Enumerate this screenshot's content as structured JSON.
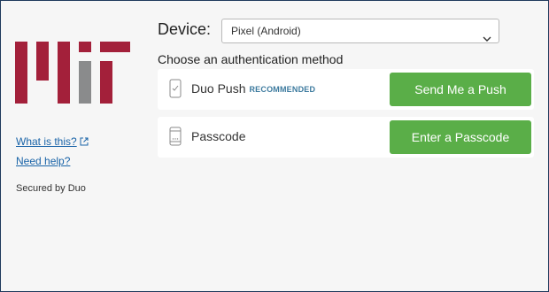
{
  "brand": {
    "logo_alt": "MIT",
    "colors": {
      "red": "#a3203a",
      "gray": "#8a8b8c"
    }
  },
  "sidebar": {
    "links": [
      {
        "label": "What is this?",
        "icon": "external-link-icon"
      },
      {
        "label": "Need help?"
      }
    ],
    "secured_text": "Secured by Duo"
  },
  "device": {
    "label": "Device:",
    "selected": "Pixel (Android)",
    "icon": "chevron-down-icon"
  },
  "methods": {
    "heading": "Choose an authentication method",
    "items": [
      {
        "label": "Duo Push",
        "badge": "RECOMMENDED",
        "icon": "phone-check-icon",
        "button_label": "Send Me a Push"
      },
      {
        "label": "Passcode",
        "icon": "phone-keypad-icon",
        "button_label": "Enter a Passcode"
      }
    ]
  },
  "colors": {
    "accent_green": "#5aae48",
    "link_blue": "#1a64a8",
    "frame_border": "#1f3a5c",
    "background": "#f6f6f6"
  }
}
